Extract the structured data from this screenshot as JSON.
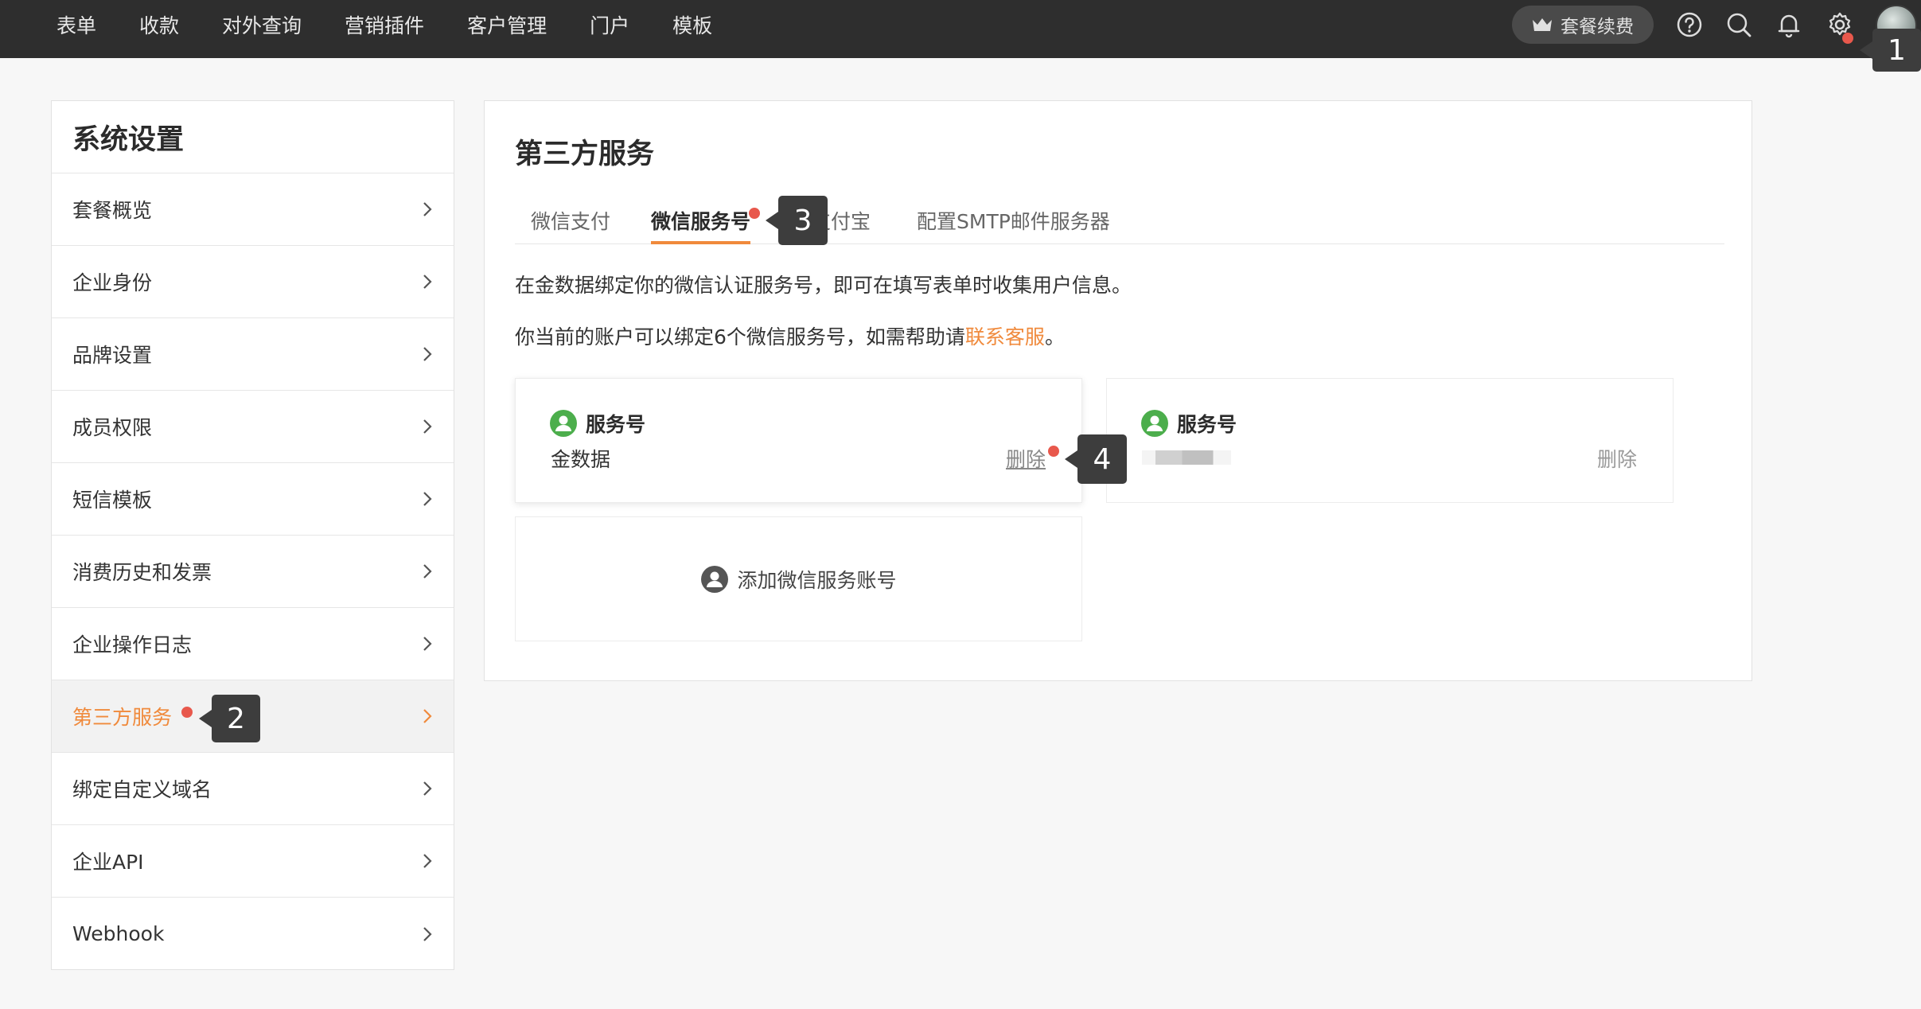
{
  "nav": {
    "items": [
      "表单",
      "收款",
      "对外查询",
      "营销插件",
      "客户管理",
      "门户",
      "模板"
    ],
    "renew_label": "套餐续费",
    "icons": [
      "help-icon",
      "search-icon",
      "bell-icon",
      "gear-icon"
    ]
  },
  "sidebar": {
    "title": "系统设置",
    "items": [
      {
        "label": "套餐概览"
      },
      {
        "label": "企业身份"
      },
      {
        "label": "品牌设置"
      },
      {
        "label": "成员权限"
      },
      {
        "label": "短信模板"
      },
      {
        "label": "消费历史和发票"
      },
      {
        "label": "企业操作日志"
      },
      {
        "label": "第三方服务"
      },
      {
        "label": "绑定自定义域名"
      },
      {
        "label": "企业API"
      },
      {
        "label": "Webhook"
      }
    ],
    "active_index": 7
  },
  "main": {
    "title": "第三方服务",
    "tabs": [
      "微信支付",
      "微信服务号",
      "支付宝",
      "配置SMTP邮件服务器"
    ],
    "active_tab": "微信服务号",
    "desc1": "在金数据绑定你的微信认证服务号，即可在填写表单时收集用户信息。",
    "desc2_prefix": "你当前的账户可以绑定6个微信服务号，如需帮助请",
    "desc2_link": "联系客服",
    "desc2_suffix": "。",
    "cards": [
      {
        "title": "服务号",
        "name": "金数据",
        "delete_label": "删除"
      },
      {
        "title": "服务号",
        "name": "",
        "delete_label": "删除"
      }
    ],
    "add_label": "添加微信服务账号"
  },
  "callouts": [
    "1",
    "2",
    "3",
    "4"
  ],
  "colors": {
    "accent": "#f08a3c",
    "topbar": "#2e2e2e",
    "dot": "#e8584c",
    "wechat_green": "#4cae4c"
  }
}
